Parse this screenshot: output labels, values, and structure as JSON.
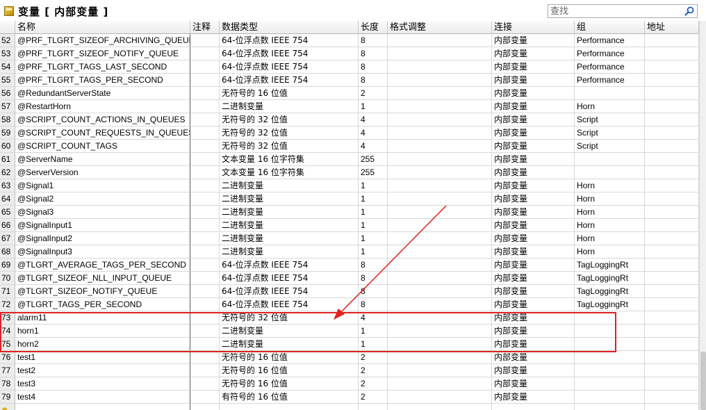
{
  "title": "变量 [ 内部变量 ]",
  "search": {
    "placeholder": "查找"
  },
  "columns": [
    "名称",
    "注释",
    "数据类型",
    "长度",
    "格式调整",
    "连接",
    "组",
    "地址"
  ],
  "rows": [
    {
      "n": "52",
      "name": "@PRF_TLGRT_SIZEOF_ARCHIVING_QUEUE",
      "comment": "",
      "type": "64-位浮点数 IEEE 754",
      "len": "8",
      "fmt": "",
      "conn": "内部变量",
      "group": "Performance",
      "addr": ""
    },
    {
      "n": "53",
      "name": "@PRF_TLGRT_SIZEOF_NOTIFY_QUEUE",
      "comment": "",
      "type": "64-位浮点数 IEEE 754",
      "len": "8",
      "fmt": "",
      "conn": "内部变量",
      "group": "Performance",
      "addr": ""
    },
    {
      "n": "54",
      "name": "@PRF_TLGRT_TAGS_LAST_SECOND",
      "comment": "",
      "type": "64-位浮点数 IEEE 754",
      "len": "8",
      "fmt": "",
      "conn": "内部变量",
      "group": "Performance",
      "addr": ""
    },
    {
      "n": "55",
      "name": "@PRF_TLGRT_TAGS_PER_SECOND",
      "comment": "",
      "type": "64-位浮点数 IEEE 754",
      "len": "8",
      "fmt": "",
      "conn": "内部变量",
      "group": "Performance",
      "addr": ""
    },
    {
      "n": "56",
      "name": "@RedundantServerState",
      "comment": "",
      "type": "无符号的 16 位值",
      "len": "2",
      "fmt": "",
      "conn": "内部变量",
      "group": "",
      "addr": ""
    },
    {
      "n": "57",
      "name": "@RestartHorn",
      "comment": "",
      "type": "二进制变量",
      "len": "1",
      "fmt": "",
      "conn": "内部变量",
      "group": "Horn",
      "addr": ""
    },
    {
      "n": "58",
      "name": "@SCRIPT_COUNT_ACTIONS_IN_QUEUES",
      "comment": "",
      "type": "无符号的 32 位值",
      "len": "4",
      "fmt": "",
      "conn": "内部变量",
      "group": "Script",
      "addr": ""
    },
    {
      "n": "59",
      "name": "@SCRIPT_COUNT_REQUESTS_IN_QUEUES",
      "comment": "",
      "type": "无符号的 32 位值",
      "len": "4",
      "fmt": "",
      "conn": "内部变量",
      "group": "Script",
      "addr": ""
    },
    {
      "n": "60",
      "name": "@SCRIPT_COUNT_TAGS",
      "comment": "",
      "type": "无符号的 32 位值",
      "len": "4",
      "fmt": "",
      "conn": "内部变量",
      "group": "Script",
      "addr": ""
    },
    {
      "n": "61",
      "name": "@ServerName",
      "comment": "",
      "type": "文本变量 16 位字符集",
      "len": "255",
      "fmt": "",
      "conn": "内部变量",
      "group": "",
      "addr": ""
    },
    {
      "n": "62",
      "name": "@ServerVersion",
      "comment": "",
      "type": "文本变量 16 位字符集",
      "len": "255",
      "fmt": "",
      "conn": "内部变量",
      "group": "",
      "addr": ""
    },
    {
      "n": "63",
      "name": "@Signal1",
      "comment": "",
      "type": "二进制变量",
      "len": "1",
      "fmt": "",
      "conn": "内部变量",
      "group": "Horn",
      "addr": ""
    },
    {
      "n": "64",
      "name": "@Signal2",
      "comment": "",
      "type": "二进制变量",
      "len": "1",
      "fmt": "",
      "conn": "内部变量",
      "group": "Horn",
      "addr": ""
    },
    {
      "n": "65",
      "name": "@Signal3",
      "comment": "",
      "type": "二进制变量",
      "len": "1",
      "fmt": "",
      "conn": "内部变量",
      "group": "Horn",
      "addr": ""
    },
    {
      "n": "66",
      "name": "@SignalInput1",
      "comment": "",
      "type": "二进制变量",
      "len": "1",
      "fmt": "",
      "conn": "内部变量",
      "group": "Horn",
      "addr": ""
    },
    {
      "n": "67",
      "name": "@SignalInput2",
      "comment": "",
      "type": "二进制变量",
      "len": "1",
      "fmt": "",
      "conn": "内部变量",
      "group": "Horn",
      "addr": ""
    },
    {
      "n": "68",
      "name": "@SignalInput3",
      "comment": "",
      "type": "二进制变量",
      "len": "1",
      "fmt": "",
      "conn": "内部变量",
      "group": "Horn",
      "addr": ""
    },
    {
      "n": "69",
      "name": "@TLGRT_AVERAGE_TAGS_PER_SECOND",
      "comment": "",
      "type": "64-位浮点数 IEEE 754",
      "len": "8",
      "fmt": "",
      "conn": "内部变量",
      "group": "TagLoggingRt",
      "addr": ""
    },
    {
      "n": "70",
      "name": "@TLGRT_SIZEOF_NLL_INPUT_QUEUE",
      "comment": "",
      "type": "64-位浮点数 IEEE 754",
      "len": "8",
      "fmt": "",
      "conn": "内部变量",
      "group": "TagLoggingRt",
      "addr": ""
    },
    {
      "n": "71",
      "name": "@TLGRT_SIZEOF_NOTIFY_QUEUE",
      "comment": "",
      "type": "64-位浮点数 IEEE 754",
      "len": "8",
      "fmt": "",
      "conn": "内部变量",
      "group": "TagLoggingRt",
      "addr": ""
    },
    {
      "n": "72",
      "name": "@TLGRT_TAGS_PER_SECOND",
      "comment": "",
      "type": "64-位浮点数 IEEE 754",
      "len": "8",
      "fmt": "",
      "conn": "内部变量",
      "group": "TagLoggingRt",
      "addr": ""
    },
    {
      "n": "73",
      "name": "alarm11",
      "comment": "",
      "type": "无符号的 32 位值",
      "len": "4",
      "fmt": "",
      "conn": "内部变量",
      "group": "",
      "addr": ""
    },
    {
      "n": "74",
      "name": "horn1",
      "comment": "",
      "type": "二进制变量",
      "len": "1",
      "fmt": "",
      "conn": "内部变量",
      "group": "",
      "addr": ""
    },
    {
      "n": "75",
      "name": "horn2",
      "comment": "",
      "type": "二进制变量",
      "len": "1",
      "fmt": "",
      "conn": "内部变量",
      "group": "",
      "addr": ""
    },
    {
      "n": "76",
      "name": "test1",
      "comment": "",
      "type": "无符号的 16 位值",
      "len": "2",
      "fmt": "",
      "conn": "内部变量",
      "group": "",
      "addr": ""
    },
    {
      "n": "77",
      "name": "test2",
      "comment": "",
      "type": "无符号的 16 位值",
      "len": "2",
      "fmt": "",
      "conn": "内部变量",
      "group": "",
      "addr": ""
    },
    {
      "n": "78",
      "name": "test3",
      "comment": "",
      "type": "无符号的 16 位值",
      "len": "2",
      "fmt": "",
      "conn": "内部变量",
      "group": "",
      "addr": ""
    },
    {
      "n": "79",
      "name": "test4",
      "comment": "",
      "type": "有符号的 16 位值",
      "len": "2",
      "fmt": "",
      "conn": "内部变量",
      "group": "",
      "addr": ""
    }
  ],
  "annotation_color": "#e02020"
}
